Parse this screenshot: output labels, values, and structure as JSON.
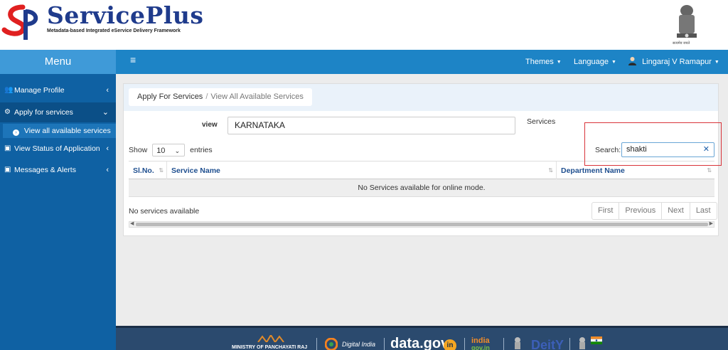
{
  "brand": {
    "title": "ServicePlus",
    "subtitle": "Metadata-based Integrated eService Delivery Framework",
    "emblem_caption": "सत्यमेव जयते"
  },
  "sidebar": {
    "menu_title": "Menu",
    "items": [
      {
        "label": "Manage Profile",
        "icon": "users-icon"
      },
      {
        "label": "Apply for services",
        "icon": "cogs-icon"
      },
      {
        "label": "View all available services",
        "icon": "chevron-circle-right-icon"
      },
      {
        "label": "View Status of Application",
        "icon": "file-icon"
      },
      {
        "label": "Messages & Alerts",
        "icon": "file-icon"
      }
    ]
  },
  "topnav": {
    "menu_icon": "hamburger-icon",
    "themes": "Themes",
    "language": "Language",
    "user": "Lingaraj V Ramapur"
  },
  "breadcrumb": {
    "parent": "Apply For Services",
    "separator": "/",
    "current": "View All Available Services"
  },
  "filters": {
    "view_label": "view",
    "view_value": "KARNATAKA",
    "services_label": "Services"
  },
  "table": {
    "show_label": "Show",
    "entries_value": "10",
    "entries_label": "entries",
    "search_label": "Search:",
    "search_value": "shakti",
    "columns": [
      "Sl.No.",
      "Service Name",
      "Department Name"
    ],
    "empty_message": "No Services available for online mode.",
    "info": "No services available",
    "pagination": [
      "First",
      "Previous",
      "Next",
      "Last"
    ]
  },
  "footer": {
    "items": [
      "MINISTRY OF PANCHAYATI RAJ",
      "Digital India",
      "data.gov",
      "in",
      "india",
      "gov.in",
      "DeitY"
    ]
  },
  "colors": {
    "sidebar": "#0f61a3",
    "topnav": "#1d84c6",
    "menu_header": "#3f9ad8",
    "highlight": "#d9343a",
    "footer": "#2b4a6e"
  }
}
